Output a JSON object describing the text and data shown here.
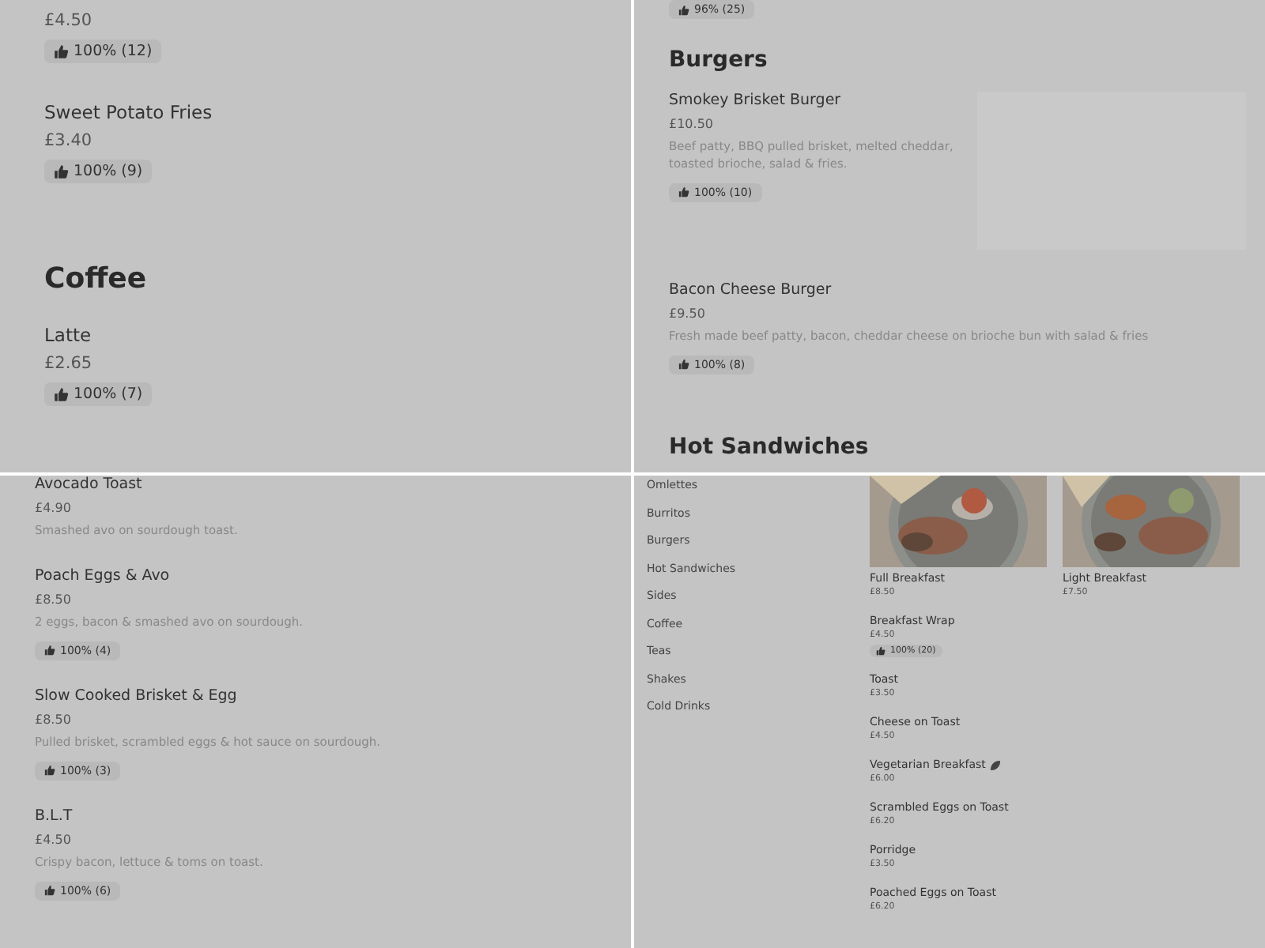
{
  "panels": [
    {
      "kind": "large",
      "blocks": [
        {
          "kind": "item",
          "price": "£4.50",
          "rating": "100% (12)"
        },
        {
          "kind": "item",
          "name": "Sweet Potato Fries",
          "price": "£3.40",
          "rating": "100% (9)"
        },
        {
          "kind": "heading",
          "text": "Coffee"
        },
        {
          "kind": "item",
          "name": "Latte",
          "price": "£2.65",
          "rating": "100% (7)"
        }
      ]
    },
    {
      "kind": "medium",
      "blocks": [
        {
          "kind": "rating",
          "rating": "96% (25)"
        },
        {
          "kind": "heading",
          "text": "Burgers"
        },
        {
          "kind": "item",
          "name": "Smokey Brisket Burger",
          "price": "£10.50",
          "description": "Beef patty, BBQ pulled brisket, melted cheddar, toasted brioche, salad & fries.",
          "rating": "100% (10)",
          "image_placeholder": true
        },
        {
          "kind": "item",
          "name": "Bacon Cheese Burger",
          "price": "£9.50",
          "description": "Fresh made beef patty, bacon, cheddar cheese on brioche bun with salad & fries",
          "rating": "100% (8)"
        },
        {
          "kind": "heading",
          "text": "Hot Sandwiches"
        }
      ]
    },
    {
      "kind": "medium",
      "blocks": [
        {
          "kind": "item",
          "name": "Avocado Toast",
          "price": "£4.90",
          "description": "Smashed avo on sourdough toast."
        },
        {
          "kind": "item",
          "name": "Poach Eggs & Avo",
          "price": "£8.50",
          "description": "2 eggs, bacon & smashed avo on sourdough.",
          "rating": "100% (4)"
        },
        {
          "kind": "item",
          "name": "Slow Cooked Brisket & Egg",
          "price": "£8.50",
          "description": "Pulled brisket, scrambled eggs & hot sauce on sourdough.",
          "rating": "100% (3)"
        },
        {
          "kind": "item",
          "name": "B.L.T",
          "price": "£4.50",
          "description": "Crispy bacon, lettuce & toms on toast.",
          "rating": "100% (6)"
        }
      ]
    },
    {
      "kind": "split",
      "categories": [
        "Omlettes",
        "Burritos",
        "Burgers",
        "Hot Sandwiches",
        "Sides",
        "Coffee",
        "Teas",
        "Shakes",
        "Cold Drinks"
      ],
      "cards": [
        {
          "name": "Full Breakfast",
          "price": "£8.50"
        },
        {
          "name": "Light Breakfast",
          "price": "£7.50"
        }
      ],
      "items": [
        {
          "name": "Breakfast Wrap",
          "price": "£4.50",
          "rating": "100% (20)"
        },
        {
          "name": "Toast",
          "price": "£3.50"
        },
        {
          "name": "Cheese on Toast",
          "price": "£4.50"
        },
        {
          "name": "Vegetarian Breakfast",
          "price": "£6.00",
          "vegetarian": true
        },
        {
          "name": "Scrambled Eggs on Toast",
          "price": "£6.20"
        },
        {
          "name": "Porridge",
          "price": "£3.50"
        },
        {
          "name": "Poached Eggs on Toast",
          "price": "£6.20"
        }
      ]
    }
  ]
}
